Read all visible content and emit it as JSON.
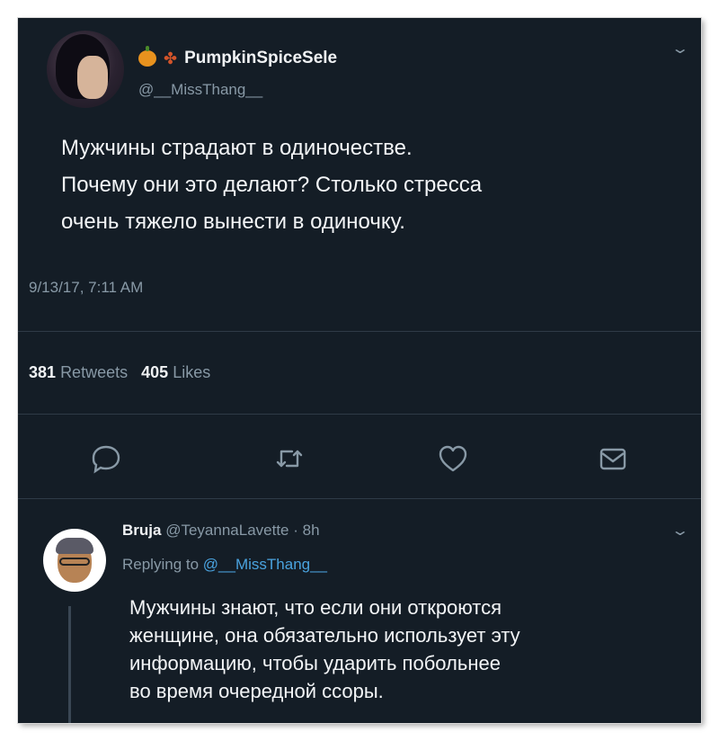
{
  "tweet": {
    "display_name": "PumpkinSpiceSele",
    "emojis": [
      "pumpkin-icon",
      "maple-leaf-icon"
    ],
    "handle": "@__MissThang__",
    "text": "Мужчины страдают в одиночестве.\nПочему они это делают? Столько стресса\nочень тяжело вынести в одиночку.",
    "timestamp": "9/13/17, 7:11 AM",
    "retweets_count": "381",
    "retweets_label": "Retweets",
    "likes_count": "405",
    "likes_label": "Likes",
    "actions": [
      "reply-icon",
      "retweet-icon",
      "like-icon",
      "share-icon"
    ]
  },
  "reply": {
    "display_name": "Bruja",
    "handle": "@TeyannaLavette",
    "separator": "·",
    "time": "8h",
    "replying_to_label": "Replying to",
    "replying_to_handle": "@__MissThang__",
    "text": "Мужчины знают, что если они откроются\nженщине, она обязательно использует эту\nинформацию, чтобы ударить побольнее\nво время очередной ссоры."
  },
  "colors": {
    "background": "#141d26",
    "text_primary": "#f3f5f7",
    "text_secondary": "#8899a6",
    "link": "#4aa3df",
    "divider": "#2f3b47"
  }
}
